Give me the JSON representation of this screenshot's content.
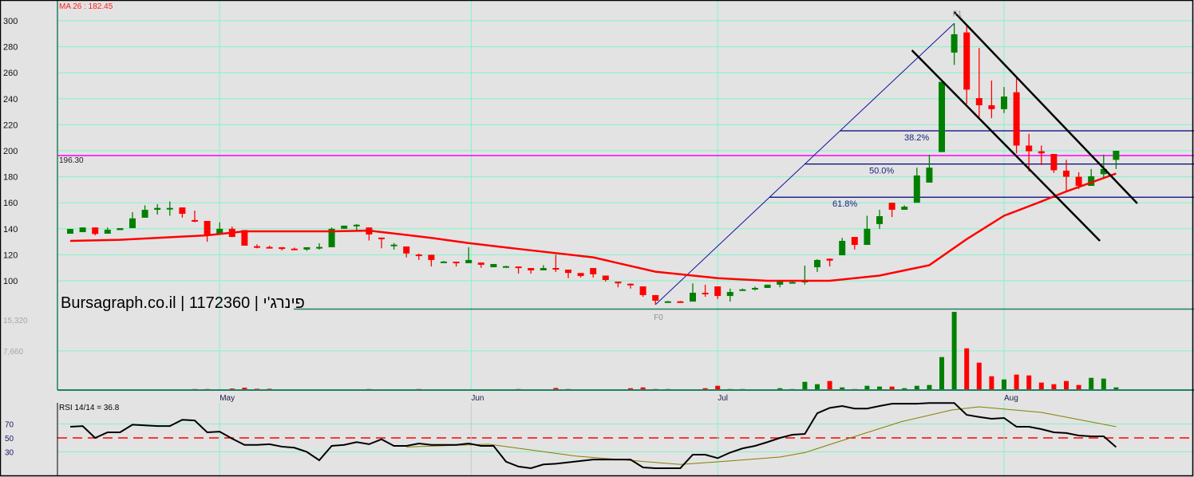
{
  "chart_data": {
    "type": "candlestick",
    "title": "Bursagraph.co.il | 1172360 | פינרג'י",
    "ylim": [
      100,
      300
    ],
    "yticks": [
      100,
      120,
      140,
      160,
      180,
      200,
      220,
      240,
      260,
      280,
      300
    ],
    "grid": true,
    "months": [
      {
        "label": "May",
        "index": 12
      },
      {
        "label": "Jun",
        "index": 32.2
      },
      {
        "label": "Jul",
        "index": 52
      },
      {
        "label": "Aug",
        "index": 75
      }
    ],
    "ohlc": [
      [
        136.2,
        139.9,
        136.2,
        139.9
      ],
      [
        137.4,
        141,
        137.4,
        141
      ],
      [
        141,
        141,
        135,
        136
      ],
      [
        136.2,
        141,
        136.2,
        139.3
      ],
      [
        139,
        140.5,
        139,
        140.5
      ],
      [
        140.5,
        152.8,
        140.5,
        148
      ],
      [
        148.5,
        158,
        148.5,
        154.6
      ],
      [
        154.6,
        158.9,
        150.9,
        156
      ],
      [
        155.5,
        161,
        150,
        156
      ],
      [
        156.4,
        156.4,
        148.5,
        151.5
      ],
      [
        146.7,
        154,
        145,
        146.5
      ],
      [
        146,
        146,
        130,
        135.6
      ],
      [
        135.6,
        145,
        135.6,
        140
      ],
      [
        140,
        141.7,
        133.7,
        133.7
      ],
      [
        139,
        139,
        127,
        127
      ],
      [
        126.6,
        128,
        125,
        126.2
      ],
      [
        126,
        127,
        125,
        125.8
      ],
      [
        125.8,
        125.8,
        123.3,
        124.5
      ],
      [
        124.7,
        125.5,
        124,
        124.4
      ],
      [
        124,
        125.8,
        123,
        125.8
      ],
      [
        125.6,
        128.8,
        124,
        126
      ],
      [
        125.8,
        141,
        125.8,
        140
      ],
      [
        140,
        142.4,
        140,
        142.4
      ],
      [
        142.8,
        143.6,
        138.7,
        143.1
      ],
      [
        141,
        141,
        131,
        135.6
      ],
      [
        133.2,
        133.2,
        125,
        132.8
      ],
      [
        127.4,
        129,
        124,
        127.8
      ],
      [
        126.4,
        126.4,
        118,
        121
      ],
      [
        120.2,
        121,
        116,
        119.9
      ],
      [
        120,
        120,
        111,
        116
      ],
      [
        114.5,
        115.2,
        114,
        114.8
      ],
      [
        114.7,
        114.7,
        111,
        113.5
      ],
      [
        113.5,
        125.8,
        113.5,
        116
      ],
      [
        114,
        114,
        110,
        112.3
      ],
      [
        110.4,
        112.9,
        110.4,
        112.9
      ],
      [
        111,
        111.5,
        110.5,
        111.2
      ],
      [
        111,
        111,
        105.5,
        110.4
      ],
      [
        109.8,
        109.8,
        105.5,
        108
      ],
      [
        108,
        112,
        108,
        109.8
      ],
      [
        109.8,
        120,
        106.8,
        108.6
      ],
      [
        108.6,
        108.6,
        102,
        106
      ],
      [
        106,
        106,
        102.5,
        103.7
      ],
      [
        109.8,
        109.8,
        102.5,
        105
      ],
      [
        104,
        104,
        99.4,
        100.6
      ],
      [
        99.4,
        99.4,
        95,
        98
      ],
      [
        97.7,
        98,
        94,
        97.3
      ],
      [
        95.7,
        95.7,
        87.7,
        89
      ],
      [
        89,
        89,
        81.6,
        84.7
      ],
      [
        83.9,
        84.5,
        83,
        84.2
      ],
      [
        84.2,
        84.5,
        83.5,
        83.9
      ],
      [
        84,
        98,
        84,
        90.8
      ],
      [
        90.8,
        97,
        87.7,
        89.6
      ],
      [
        95.7,
        95.7,
        86,
        88.3
      ],
      [
        88.3,
        94,
        84,
        91.4
      ],
      [
        93,
        94,
        93,
        93.4
      ],
      [
        93.3,
        95.5,
        92.5,
        94.5
      ],
      [
        94.5,
        97,
        94.5,
        97
      ],
      [
        97,
        99.4,
        95,
        99.4
      ],
      [
        98.6,
        100.2,
        98,
        99
      ],
      [
        98.8,
        111.7,
        97,
        100
      ],
      [
        110.4,
        116.6,
        106.8,
        116
      ],
      [
        117,
        117,
        111,
        115.5
      ],
      [
        119.6,
        133,
        119.6,
        130.7
      ],
      [
        133.7,
        133.7,
        124,
        127.6
      ],
      [
        127.6,
        150,
        127.6,
        140
      ],
      [
        143.6,
        154.6,
        140,
        149.7
      ],
      [
        160,
        160,
        149,
        154.6
      ],
      [
        154.6,
        158,
        154.6,
        157
      ],
      [
        160,
        187,
        160,
        181
      ],
      [
        175.5,
        197,
        175.5,
        187
      ],
      [
        199,
        253,
        199,
        253
      ],
      [
        275.5,
        298,
        266,
        289.6
      ],
      [
        291,
        296,
        236,
        247
      ],
      [
        240.5,
        279,
        226,
        235
      ],
      [
        235,
        254,
        225,
        232
      ],
      [
        232,
        249,
        229,
        241.7
      ],
      [
        245,
        256,
        198,
        204
      ],
      [
        204,
        213,
        184,
        199.6
      ],
      [
        199.6,
        204,
        189,
        198
      ],
      [
        197.5,
        197.5,
        183,
        185
      ],
      [
        184.7,
        193,
        169,
        180
      ],
      [
        180,
        183.5,
        170.5,
        173
      ],
      [
        173,
        186,
        173,
        180.4
      ],
      [
        182,
        197,
        179,
        186
      ],
      [
        193,
        200,
        186,
        200
      ]
    ],
    "ma": {
      "label": "MA 26 : 182.45",
      "color": "#ff0000",
      "points": [
        [
          0,
          130.7
        ],
        [
          4,
          131.5
        ],
        [
          11,
          135
        ],
        [
          14,
          138
        ],
        [
          21,
          138
        ],
        [
          24,
          138.6
        ],
        [
          29,
          133
        ],
        [
          32,
          129
        ],
        [
          36,
          124.5
        ],
        [
          42,
          118
        ],
        [
          47,
          107
        ],
        [
          52,
          102
        ],
        [
          56,
          100
        ],
        [
          61,
          100
        ],
        [
          65,
          104
        ],
        [
          69,
          112
        ],
        [
          72,
          132
        ],
        [
          75,
          150
        ],
        [
          78,
          161
        ],
        [
          80,
          168.7
        ],
        [
          84,
          182.5
        ]
      ]
    },
    "horizontal_line": {
      "value": 196.3,
      "label": "196.30",
      "color": "#ff00ff"
    },
    "fibonacci": {
      "start": {
        "index": 47,
        "price": 81.6,
        "label": "F0"
      },
      "end": {
        "index": 71,
        "price": 298,
        "label": "F1"
      },
      "levels": [
        {
          "ratio": 0.382,
          "label": "38.2%"
        },
        {
          "ratio": 0.5,
          "label": "50.0%"
        },
        {
          "ratio": 0.618,
          "label": "61.8%"
        }
      ]
    },
    "trendlines": [
      {
        "from": [
          67.6,
          277.3
        ],
        "to": [
          82.7,
          130.7
        ]
      },
      {
        "from": [
          71.0,
          306.7
        ],
        "to": [
          85.7,
          159.5
        ]
      }
    ],
    "volume": {
      "yticks": [
        {
          "value": 15320,
          "label": "15,320"
        },
        {
          "value": 7660,
          "label": "7,660"
        }
      ],
      "values": [
        0,
        0,
        0,
        0,
        0,
        150,
        0,
        0,
        0,
        0,
        200,
        200,
        150,
        300,
        470,
        250,
        250,
        0,
        0,
        0,
        0,
        0,
        0,
        0,
        200,
        0,
        0,
        0,
        200,
        0,
        0,
        0,
        150,
        0,
        0,
        0,
        200,
        0,
        0,
        400,
        200,
        0,
        0,
        0,
        0,
        360,
        520,
        200,
        200,
        0,
        0,
        360,
        830,
        200,
        200,
        0,
        0,
        360,
        200,
        1610,
        1150,
        1770,
        520,
        200,
        830,
        680,
        680,
        360,
        830,
        990,
        6450,
        15300,
        8160,
        5360,
        2700,
        2080,
        3020,
        2860,
        1460,
        1150,
        1770,
        990,
        2390,
        2240,
        520
      ]
    },
    "rsi": {
      "label": "RSI 14/14 = 36.8",
      "levels": [
        70,
        50,
        30
      ],
      "values": [
        66,
        67,
        50,
        58,
        58,
        69,
        68,
        67,
        67,
        76,
        75,
        58,
        59,
        49,
        40,
        40,
        41,
        37.5,
        36,
        30,
        18,
        38.6,
        40,
        44,
        41,
        48,
        38.6,
        38.6,
        42,
        40,
        40,
        40,
        42,
        38.6,
        38.6,
        16,
        9,
        6.6,
        12,
        13,
        15,
        17,
        19,
        19,
        19,
        19,
        7.7,
        6.6,
        6.6,
        6.6,
        26,
        26,
        21,
        29,
        35,
        38.6,
        44,
        50,
        54.6,
        55.7,
        85.4,
        93,
        95.7,
        92,
        92,
        95.7,
        99,
        99,
        99,
        100,
        100,
        100,
        83,
        80,
        77.4,
        78.6,
        66,
        66,
        62.6,
        58,
        57,
        53.4,
        52.3,
        52.3,
        36.8
      ],
      "signal": [
        [
          27,
          37
        ],
        [
          33.6,
          41
        ],
        [
          40.6,
          24
        ],
        [
          49,
          12
        ],
        [
          52,
          15.7
        ],
        [
          57,
          22.6
        ],
        [
          59,
          29
        ],
        [
          63,
          52
        ],
        [
          66.7,
          73
        ],
        [
          70.8,
          90
        ],
        [
          73,
          94.6
        ],
        [
          78,
          86.6
        ],
        [
          84,
          66
        ]
      ]
    },
    "colors": {
      "up": "#008000",
      "down": "#ff0000",
      "grid": "#7ff5c8",
      "fib": "#000080",
      "signal": "#808000"
    }
  }
}
